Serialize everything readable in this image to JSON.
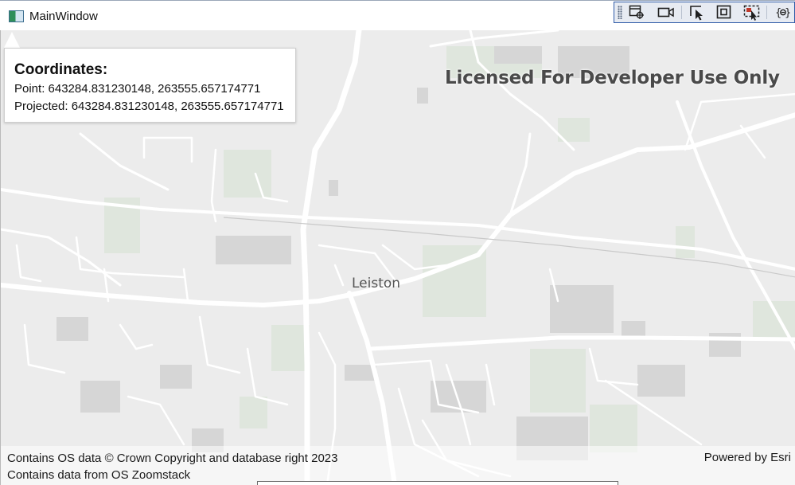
{
  "window": {
    "title": "MainWindow"
  },
  "debug_toolbar": {
    "buttons": [
      {
        "icon": "live-visual-tree-icon"
      },
      {
        "icon": "video-camera-icon"
      },
      {
        "icon": "select-element-icon"
      },
      {
        "icon": "display-layout-adorners-icon"
      },
      {
        "icon": "track-focused-element-icon"
      },
      {
        "icon": "binding-failures-icon"
      }
    ]
  },
  "map": {
    "place_label": "Leiston",
    "watermark": "Licensed For Developer Use Only",
    "colors": {
      "background": "#ececec",
      "road": "#ffffff",
      "green": "#dfe6dd",
      "building": "#d6d6d6"
    }
  },
  "coordinates": {
    "heading": "Coordinates:",
    "point_line": "Point: 643284.831230148, 263555.657174771",
    "projected_line": "Projected: 643284.831230148, 263555.657174771"
  },
  "attribution": {
    "line1": "Contains OS data © Crown Copyright and database right 2023",
    "line2": "Contains data from OS Zoomstack",
    "powered_by": "Powered by Esri"
  }
}
